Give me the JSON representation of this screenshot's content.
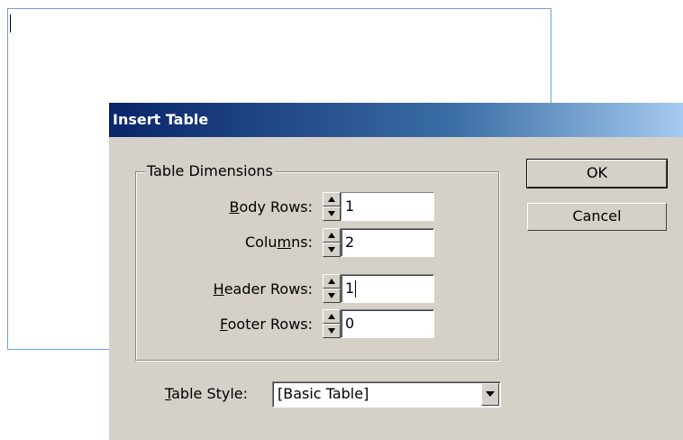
{
  "dialog": {
    "title": "Insert Table",
    "group_label": "Table Dimensions",
    "rows": [
      {
        "prefix": "",
        "accel": "B",
        "suffix": "ody Rows:",
        "value": "1"
      },
      {
        "prefix": "Colu",
        "accel": "m",
        "suffix": "ns:",
        "value": "2"
      },
      {
        "prefix": "",
        "accel": "H",
        "suffix": "eader Rows:",
        "value": "1"
      },
      {
        "prefix": "",
        "accel": "F",
        "suffix": "ooter Rows:",
        "value": "0"
      }
    ],
    "ok_label": "OK",
    "cancel_label": "Cancel",
    "table_style": {
      "accel": "T",
      "suffix": "able Style:",
      "value": "[Basic Table]"
    }
  },
  "icons": {
    "spin_up": "spin-up-arrow-icon",
    "spin_down": "spin-down-arrow-icon",
    "dropdown": "chevron-down-icon"
  },
  "colors": {
    "dialog_bg": "#d5d0c8",
    "titlebar_start": "#0a246a",
    "titlebar_end": "#a6caf0",
    "frame_border": "#6f9fe0"
  }
}
